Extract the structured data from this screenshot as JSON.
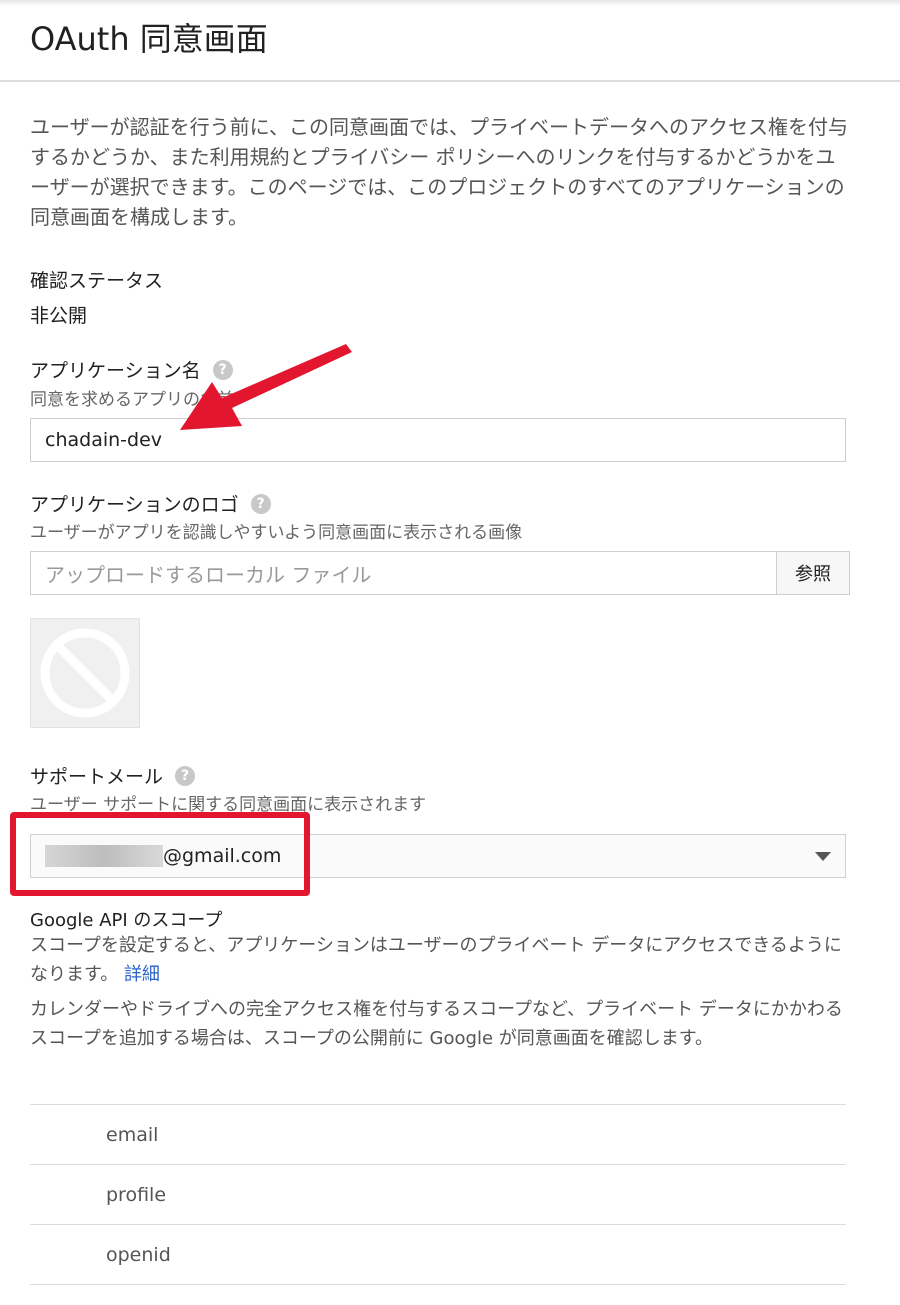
{
  "page": {
    "title": "OAuth 同意画面"
  },
  "intro": "ユーザーが認証を行う前に、この同意画面では、プライベートデータへのアクセス権を付与するかどうか、また利用規約とプライバシー ポリシーへのリンクを付与するかどうかをユーザーが選択できます。このページでは、このプロジェクトのすべてのアプリケーションの同意画面を構成します。",
  "verification": {
    "label": "確認ステータス",
    "value": "非公開"
  },
  "app_name": {
    "label": "アプリケーション名",
    "help_icon": "question-circle-icon",
    "sub": "同意を求めるアプリの名前",
    "value": "chadain-dev"
  },
  "app_logo": {
    "label": "アプリケーションのロゴ",
    "help_icon": "question-circle-icon",
    "sub": "ユーザーがアプリを認識しやすいよう同意画面に表示される画像",
    "placeholder": "アップロードするローカル ファイル",
    "browse_label": "参照",
    "preview_icon": "no-image-icon"
  },
  "support_email": {
    "label": "サポートメール",
    "help_icon": "question-circle-icon",
    "sub": "ユーザー サポートに関する同意画面に表示されます",
    "value_suffix": "@gmail.com",
    "dropdown_icon": "caret-down-icon"
  },
  "scopes": {
    "title": "Google API のスコープ",
    "desc1": "スコープを設定すると、アプリケーションはユーザーのプライベート データにアクセスできるようになります。",
    "detail_link": "詳細",
    "desc2": "カレンダーやドライブへの完全アクセス権を付与するスコープなど、プライベート データにかかわるスコープを追加する場合は、スコープの公開前に Google が同意画面を確認します。",
    "items": [
      "email",
      "profile",
      "openid"
    ]
  },
  "annotations": {
    "arrow_color": "#e2172f",
    "box_color": "#e2172f"
  }
}
